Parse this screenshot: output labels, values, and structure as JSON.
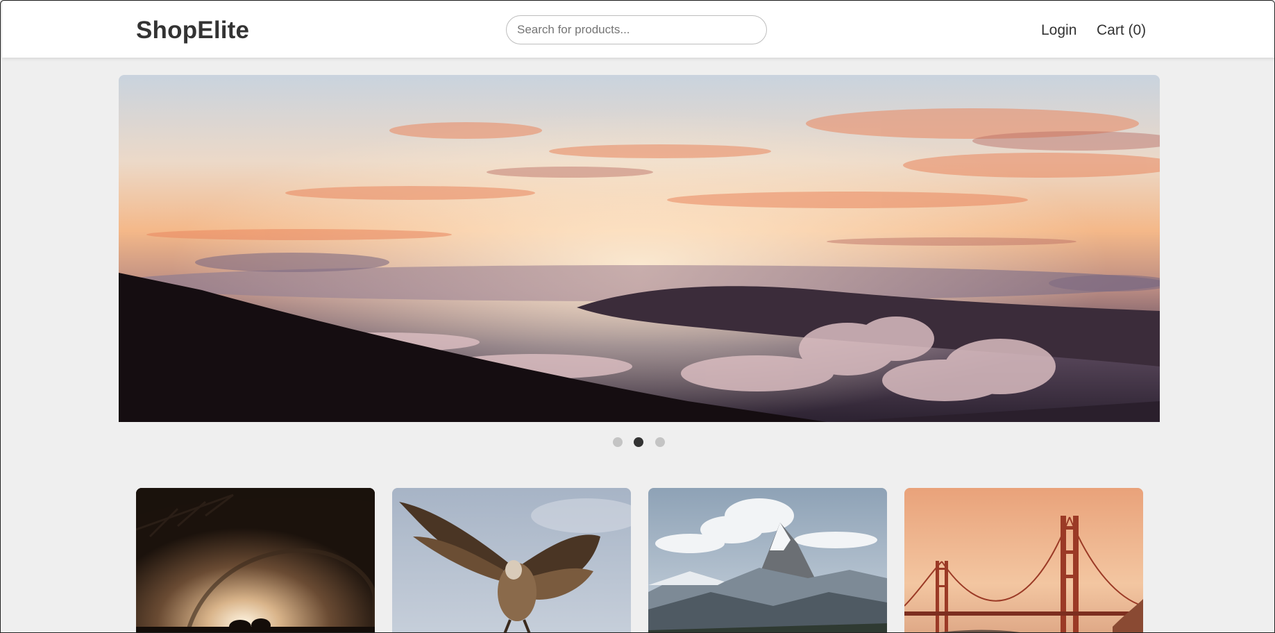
{
  "header": {
    "logo": "ShopElite",
    "search_placeholder": "Search for products...",
    "search_value": "",
    "login_label": "Login",
    "cart_label": "Cart (0)"
  },
  "carousel": {
    "slide_count": 3,
    "active_index": 1,
    "current_image": "sunset-over-clouds-mountain"
  },
  "products": [
    {
      "image": "concert-stage-lights"
    },
    {
      "image": "vulture-in-flight"
    },
    {
      "image": "snowy-mountain-peak"
    },
    {
      "image": "golden-gate-bridge-sunset"
    }
  ],
  "colors": {
    "page_bg": "#efefef",
    "header_bg": "#ffffff",
    "text": "#333333",
    "dot_active": "#333333",
    "dot_inactive": "#c4c4c4"
  }
}
